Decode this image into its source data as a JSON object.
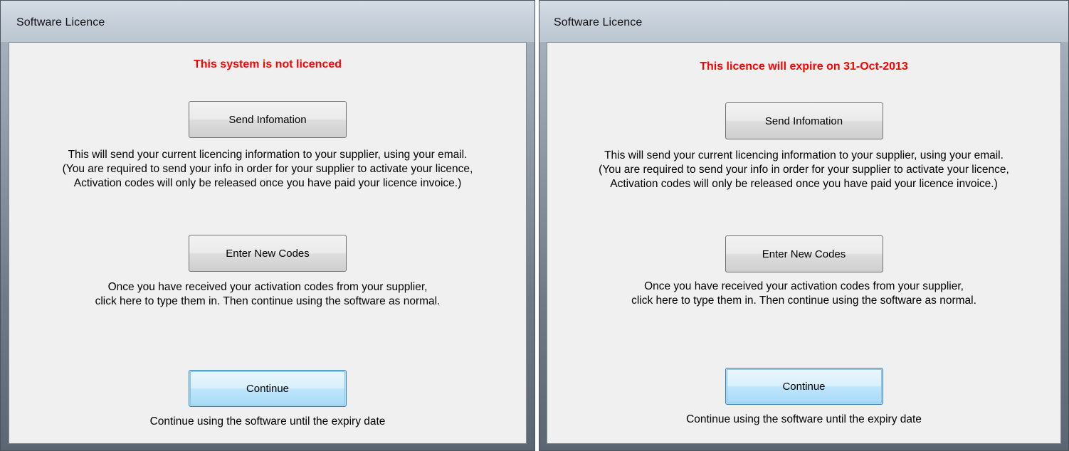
{
  "dialogs": [
    {
      "title": "Software Licence",
      "status": "This system is not licenced",
      "send_button": "Send Infomation",
      "send_text": [
        "This will send your current licencing information to your supplier, using your email.",
        "(You are required to send your info in order for your supplier to activate your licence,",
        "Activation codes will only be released once you have paid your licence invoice.)"
      ],
      "codes_button": "Enter New Codes",
      "codes_text": [
        "Once you have received your activation codes from your supplier,",
        "click here to type them in. Then continue using the software as normal."
      ],
      "continue_button": "Continue",
      "continue_text": "Continue using the software until the expiry date"
    },
    {
      "title": "Software Licence",
      "status": "This licence will expire on 31-Oct-2013",
      "send_button": "Send Infomation",
      "send_text": [
        "This will send your current licencing information to your supplier, using your email.",
        "(You are required to send your info in order for your supplier to activate your licence,",
        "Activation codes will only be released once you have paid your licence invoice.)"
      ],
      "codes_button": "Enter New Codes",
      "codes_text": [
        "Once you have received your activation codes from your supplier,",
        "click here to type them in. Then continue using the software as normal."
      ],
      "continue_button": "Continue",
      "continue_text": "Continue using the software until the expiry date"
    }
  ],
  "colors": {
    "status_text": "#ff0000",
    "dialog_background": "#f0f0f0",
    "default_button_border": "#3c7fb1"
  }
}
